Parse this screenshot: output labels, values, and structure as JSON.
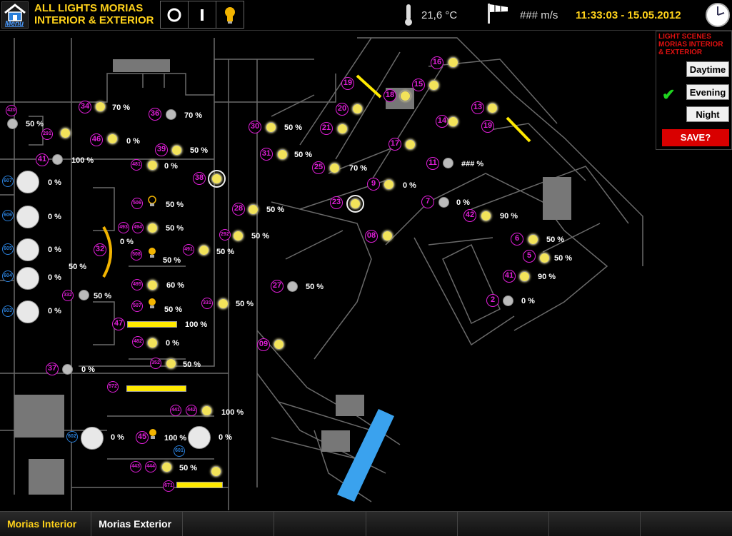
{
  "header": {
    "menu_label": "Menu",
    "title_line1": "ALL LIGHTS MORIAS",
    "title_line2": "INTERIOR & EXTERIOR",
    "mode_buttons": [
      "off-icon",
      "on-icon",
      "bulb-icon"
    ],
    "temperature": "21,6 °C",
    "wind_speed": "### m/s",
    "datetime": "11:33:03 - 15.05.2012"
  },
  "scenes": {
    "title_line1": "LIGHT SCENES",
    "title_line2": "MORIAS INTERIOR",
    "title_line3": "& EXTERIOR",
    "buttons": [
      "Daytime",
      "Evening",
      "Night"
    ],
    "active_scene": "Evening",
    "save_label": "SAVE?"
  },
  "tabs": [
    "Morias Interior",
    "Morias Exterior"
  ],
  "active_tab": "Morias Interior",
  "map": {
    "labels": [
      "420",
      "291",
      "34",
      "46",
      "36",
      "41",
      "481",
      "39",
      "38",
      "30",
      "31",
      "20",
      "21",
      "19",
      "18",
      "15",
      "16",
      "17",
      "13",
      "14",
      "19",
      "25",
      "9",
      "11",
      "23",
      "7",
      "42",
      "28",
      "506",
      "493",
      "494",
      "292",
      "32",
      "508",
      "491",
      "08",
      "6",
      "5",
      "41",
      "27",
      "495",
      "332",
      "331",
      "507",
      "2",
      "47",
      "482",
      "09",
      "37",
      "352",
      "572",
      "441",
      "442",
      "45",
      "443",
      "444",
      "671",
      "601",
      "602",
      "603",
      "604",
      "605",
      "606",
      "607"
    ],
    "values": {
      "l420": "50 %",
      "l46": "0 %",
      "l34": "70 %",
      "l36": "70 %",
      "l41": "100 %",
      "l481": "0 %",
      "l39": "50 %",
      "l30": "50 %",
      "l31": "50 %",
      "l25": "70 %",
      "l9": "0 %",
      "l11": "### %",
      "l7": "0 %",
      "l42": "90 %",
      "l28": "50 %",
      "l506": "50 %",
      "l494": "50 %",
      "l32": "0 %",
      "l292": "50 %",
      "l491": "50 %",
      "l508": "50 %",
      "l6": "50 %",
      "l5": "50 %",
      "l41b": "90 %",
      "l27": "50 %",
      "l495": "60 %",
      "l332": "50 %",
      "l331": "50 %",
      "l507": "50 %",
      "l2": "0 %",
      "l47": "100 %",
      "l482": "0 %",
      "l37": "0 %",
      "l352": "50 %",
      "l442": "100 %",
      "l45": "100 %",
      "l444": "50 %",
      "l605b": "50 %",
      "f607": "0 %",
      "f606": "0 %",
      "f605": "0 %",
      "f604": "0 %",
      "f603": "0 %",
      "f602": "0 %",
      "f601": "0 %"
    }
  }
}
